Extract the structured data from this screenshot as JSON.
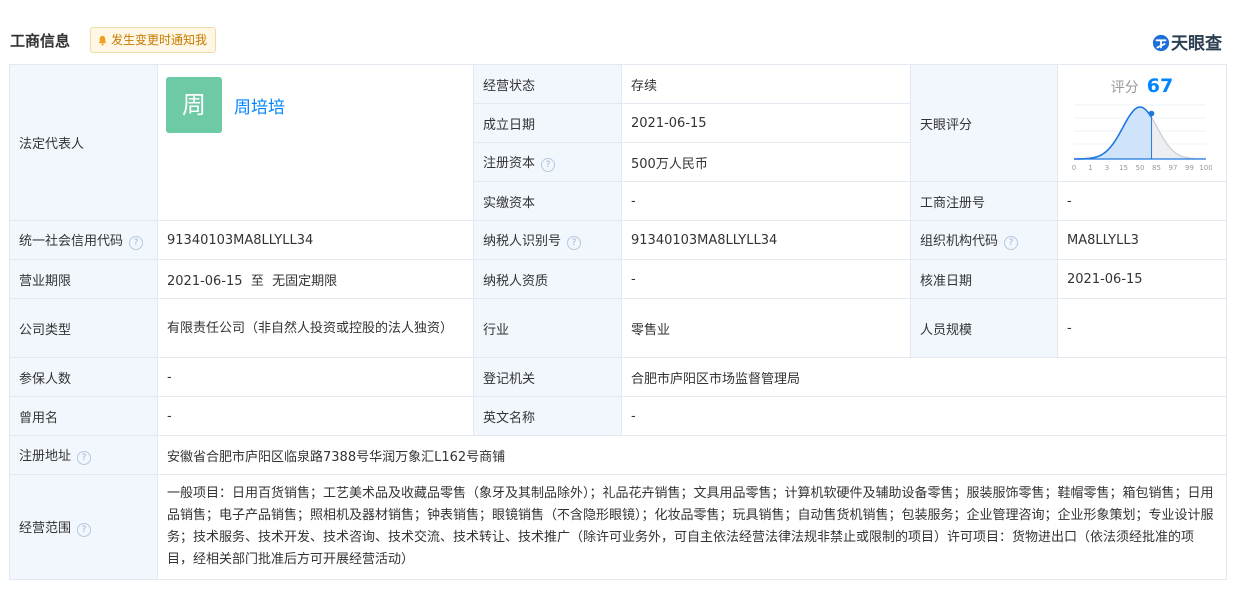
{
  "header": {
    "title": "工商信息",
    "notify_label": "发生变更时通知我",
    "brand": "天眼查"
  },
  "legal": {
    "label": "法定代表人",
    "avatar_char": "周",
    "name": "周培培"
  },
  "status": {
    "label": "经营状态",
    "value": "存续"
  },
  "established": {
    "label": "成立日期",
    "value": "2021-06-15"
  },
  "reg_capital": {
    "label": "注册资本",
    "value": "500万人民币"
  },
  "paid_capital": {
    "label": "实缴资本",
    "value": "-"
  },
  "tianyan_score": {
    "label": "天眼评分",
    "score_label": "评分",
    "score": 67
  },
  "reg_number": {
    "label": "工商注册号",
    "value": "-"
  },
  "credit_code": {
    "label": "统一社会信用代码",
    "value": "91340103MA8LLYLL34"
  },
  "taxpayer_id": {
    "label": "纳税人识别号",
    "value": "91340103MA8LLYLL34"
  },
  "org_code": {
    "label": "组织机构代码",
    "value": "MA8LLYLL3"
  },
  "term": {
    "label": "营业期限",
    "value": "2021-06-15  至  无固定期限"
  },
  "taxpayer_quality": {
    "label": "纳税人资质",
    "value": "-"
  },
  "approval_date": {
    "label": "核准日期",
    "value": "2021-06-15"
  },
  "company_type": {
    "label": "公司类型",
    "value": "有限责任公司（非自然人投资或控股的法人独资）"
  },
  "industry": {
    "label": "行业",
    "value": "零售业"
  },
  "staff_size": {
    "label": "人员规模",
    "value": "-"
  },
  "insured": {
    "label": "参保人数",
    "value": "-"
  },
  "registry": {
    "label": "登记机关",
    "value": "合肥市庐阳区市场监督管理局"
  },
  "former_name": {
    "label": "曾用名",
    "value": "-"
  },
  "english_name": {
    "label": "英文名称",
    "value": "-"
  },
  "address": {
    "label": "注册地址",
    "value": "安徽省合肥市庐阳区临泉路7388号华润万象汇L162号商铺"
  },
  "scope": {
    "label": "经营范围",
    "value": "一般项目：日用百货销售；工艺美术品及收藏品零售（象牙及其制品除外）；礼品花卉销售；文具用品零售；计算机软硬件及辅助设备零售；服装服饰零售；鞋帽零售；箱包销售；日用品销售；电子产品销售；照相机及器材销售；钟表销售；眼镜销售（不含隐形眼镜）；化妆品零售；玩具销售；自动售货机销售；包装服务；企业管理咨询；企业形象策划；专业设计服务；技术服务、技术开发、技术咨询、技术交流、技术转让、技术推广（除许可业务外，可自主依法经营法律法规非禁止或限制的项目）许可项目：货物进出口（依法须经批准的项目，经相关部门批准后方可开展经营活动）"
  },
  "colors": {
    "accent": "#0084ff",
    "label_bg": "#f2f7fd",
    "border": "#e4e9f1",
    "avatar": "#6dcaa5"
  },
  "chart_data": {
    "type": "area",
    "x": [
      "0",
      "1",
      "3",
      "15",
      "50",
      "85",
      "97",
      "99",
      "100"
    ],
    "marker": 67
  }
}
